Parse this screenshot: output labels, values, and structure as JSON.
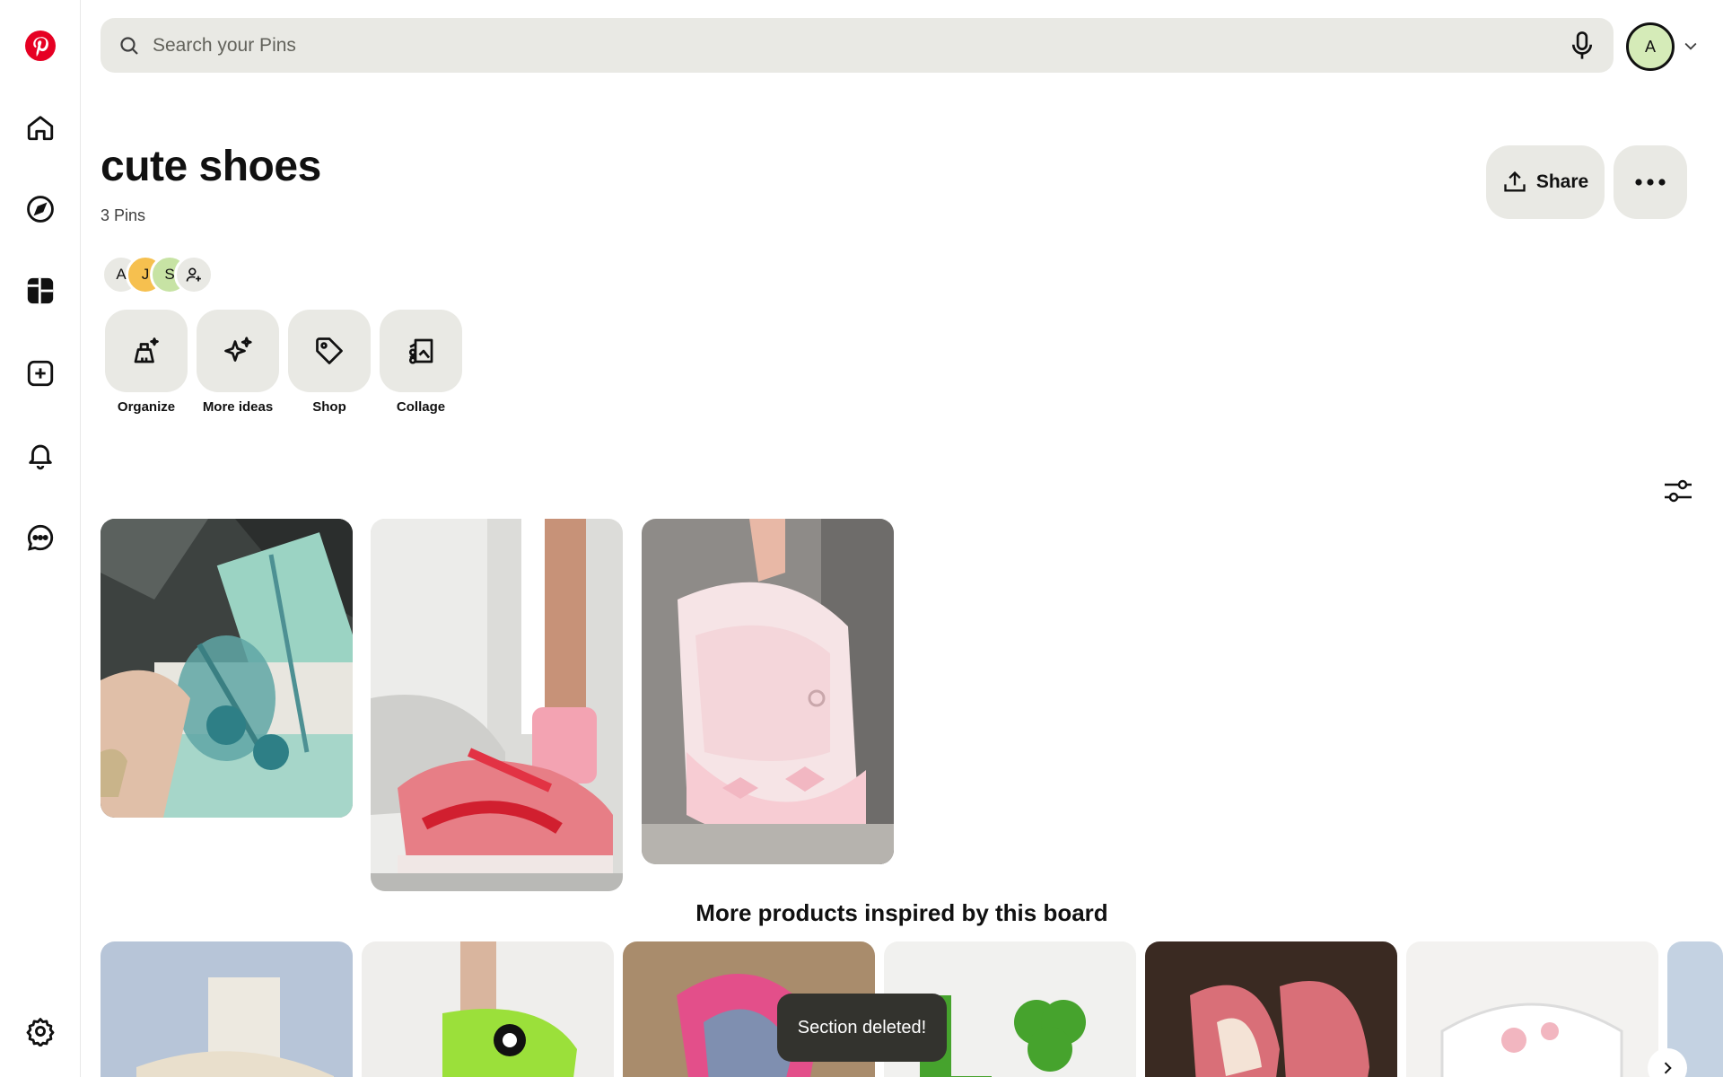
{
  "app": {
    "name": "Pinterest",
    "brand_color": "#e60023"
  },
  "sidebar": {
    "items": [
      {
        "name": "home",
        "icon": "home-icon"
      },
      {
        "name": "explore",
        "icon": "compass-icon"
      },
      {
        "name": "boards",
        "icon": "boards-icon",
        "active": true
      },
      {
        "name": "create",
        "icon": "plus-square-icon"
      },
      {
        "name": "notifications",
        "icon": "bell-icon"
      },
      {
        "name": "messages",
        "icon": "chat-icon"
      }
    ],
    "bottom": {
      "name": "settings",
      "icon": "gear-icon"
    }
  },
  "header": {
    "search_placeholder": "Search your Pins",
    "avatar_initial": "A"
  },
  "board": {
    "title": "cute shoes",
    "pin_count": "3 Pins",
    "share_label": "Share",
    "collaborators": [
      {
        "initial": "A",
        "color": "#e9e9e4"
      },
      {
        "initial": "J",
        "color": "#f6c04f"
      },
      {
        "initial": "S",
        "color": "#c7e3a4"
      }
    ],
    "tools": [
      {
        "label": "Organize",
        "icon": "broom-sparkle-icon"
      },
      {
        "label": "More ideas",
        "icon": "sparkles-icon"
      },
      {
        "label": "Shop",
        "icon": "tag-icon"
      },
      {
        "label": "Collage",
        "icon": "collage-scissors-icon"
      }
    ]
  },
  "pins": [
    {
      "description": "teal jelly flower heels",
      "color": "#8fc9bb"
    },
    {
      "description": "pink red sneakers with pink sock",
      "color": "#e6868c"
    },
    {
      "description": "pink bow platform mary janes",
      "color": "#f2d6d6"
    }
  ],
  "more_products": {
    "heading": "More products inspired by this board"
  },
  "toast": {
    "message": "Section deleted!"
  }
}
